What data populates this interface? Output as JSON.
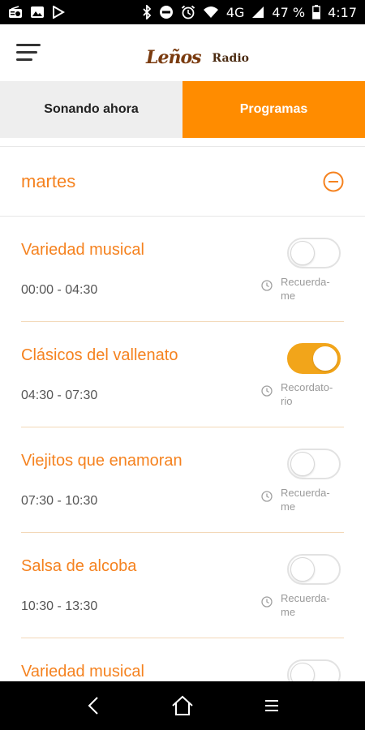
{
  "status_bar": {
    "signal": "4G",
    "battery": "47 %",
    "time": "4:17"
  },
  "app_bar": {
    "logo_script": "Leños",
    "logo_radio": "Radio"
  },
  "tabs": [
    {
      "label": "Sonando ahora",
      "active": false
    },
    {
      "label": "Programas",
      "active": true
    }
  ],
  "schedule": {
    "day": "martes",
    "programs": [
      {
        "title": "Variedad musical",
        "time": "00:00 - 04:30",
        "reminder_on": false,
        "reminder_label": "Recuerda-\nme"
      },
      {
        "title": "Clásicos del vallenato",
        "time": "04:30 - 07:30",
        "reminder_on": true,
        "reminder_label": "Recordato-\nrio"
      },
      {
        "title": "Viejitos que enamoran",
        "time": "07:30 - 10:30",
        "reminder_on": false,
        "reminder_label": "Recuerda-\nme"
      },
      {
        "title": "Salsa de alcoba",
        "time": "10:30 - 13:30",
        "reminder_on": false,
        "reminder_label": "Recuerda-\nme"
      },
      {
        "title": "Variedad musical",
        "time": "",
        "reminder_on": false,
        "reminder_label": ""
      }
    ]
  },
  "colors": {
    "accent": "#ff8c00",
    "title_orange": "#f5821f",
    "toggle_on": "#f2a51a"
  }
}
